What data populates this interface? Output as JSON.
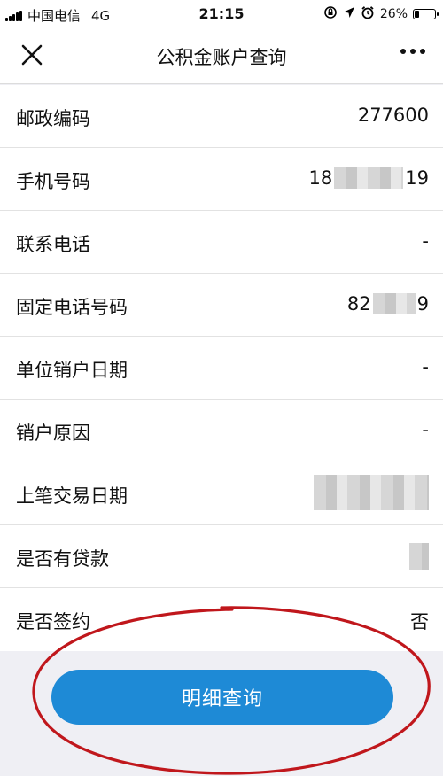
{
  "status_bar": {
    "carrier": "中国电信",
    "network": "4G",
    "time": "21:15",
    "battery": "26%",
    "battery_level": 0.26
  },
  "nav": {
    "title": "公积金账户查询",
    "close_icon": "close-icon",
    "more_icon": "more-icon"
  },
  "rows": [
    {
      "label": "邮政编码",
      "value": "277600"
    },
    {
      "label": "手机号码",
      "value_prefix": "18",
      "value_suffix": "19"
    },
    {
      "label": "联系电话",
      "value": "-"
    },
    {
      "label": "固定电话号码",
      "value_prefix": "82",
      "value_suffix": "9"
    },
    {
      "label": "单位销户日期",
      "value": "-"
    },
    {
      "label": "销户原因",
      "value": "-"
    },
    {
      "label": "上笔交易日期",
      "value": ""
    },
    {
      "label": "是否有贷款",
      "value": ""
    },
    {
      "label": "是否签约",
      "value": "否"
    }
  ],
  "button": {
    "label": "明细查询"
  },
  "colors": {
    "button": "#1e8ad6",
    "annotation": "#c0171c"
  }
}
